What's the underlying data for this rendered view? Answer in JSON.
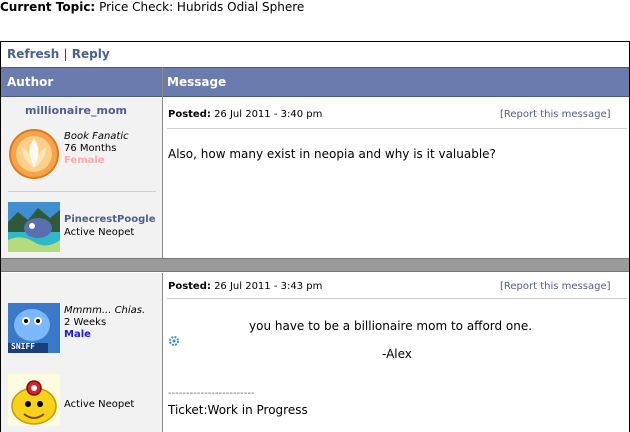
{
  "topic": {
    "label": "Current Topic:",
    "title": "Price Check: Hubrids Odial Sphere"
  },
  "toolbar": {
    "refresh": "Refresh",
    "separator": "|",
    "reply": "Reply"
  },
  "table": {
    "author_header": "Author",
    "message_header": "Message"
  },
  "posts": [
    {
      "username": "millionaire_mom",
      "title": "Book Fanatic",
      "age": "76 Months",
      "gender": "Female",
      "gender_color": "#ffaaaa",
      "pet_name": "PinecrestPoogle",
      "pet_status": "Active Neopet",
      "posted_label": "Posted:",
      "posted_time": "26 Jul 2011 - 3:40 pm",
      "report_label": "Report this message",
      "message": "Also, how many exist in neopia and why is it valuable?"
    },
    {
      "username": "",
      "title": "Mmmm... Chias.",
      "age": "2 Weeks",
      "gender": "Male",
      "gender_color": "#1a1ae6",
      "pet_name": "",
      "pet_status": "Active Neopet",
      "posted_label": "Posted:",
      "posted_time": "26 Jul 2011 - 3:43 pm",
      "report_label": "Report this message",
      "message_line1": "you have to be a billionaire mom to afford one.",
      "message_line2": "-Alex",
      "signature_rule": "------------------------",
      "signature": "Ticket:Work in Progress",
      "avatar_tag": "SNIFF"
    }
  ],
  "colors": {
    "header_bg": "#6a7cad",
    "link": "#4d5f8f",
    "author_bg": "#f2f2f2",
    "separator": "#9a9a9a"
  }
}
